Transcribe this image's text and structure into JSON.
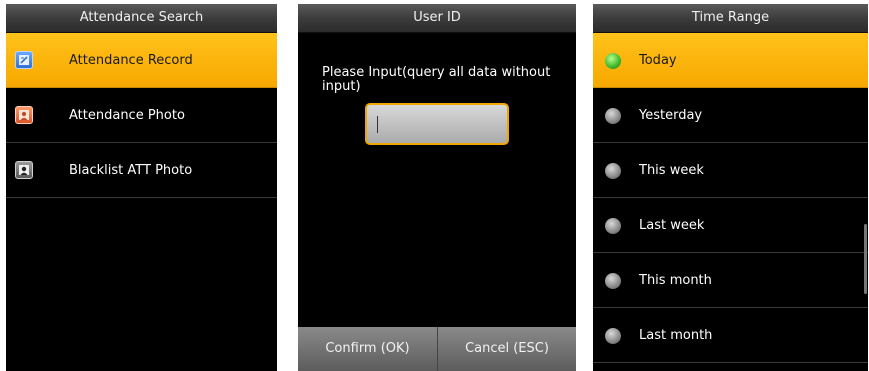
{
  "attendance_search": {
    "title": "Attendance Search",
    "items": [
      {
        "label": "Attendance Record",
        "icon": "record-icon",
        "selected": true
      },
      {
        "label": "Attendance Photo",
        "icon": "photo-icon",
        "selected": false
      },
      {
        "label": "Blacklist ATT Photo",
        "icon": "blacklist-photo-icon",
        "selected": false
      }
    ]
  },
  "user_id": {
    "title": "User ID",
    "prompt": "Please Input(query all data without input)",
    "value": "",
    "confirm_label": "Confirm (OK)",
    "cancel_label": "Cancel (ESC)"
  },
  "time_range": {
    "title": "Time Range",
    "options": [
      {
        "label": "Today",
        "selected": true
      },
      {
        "label": "Yesterday",
        "selected": false
      },
      {
        "label": "This week",
        "selected": false
      },
      {
        "label": "Last week",
        "selected": false
      },
      {
        "label": "This month",
        "selected": false
      },
      {
        "label": "Last month",
        "selected": false
      }
    ]
  },
  "colors": {
    "highlight": "#f7a800",
    "background": "#000000",
    "radio_on": "#3bb62a"
  }
}
